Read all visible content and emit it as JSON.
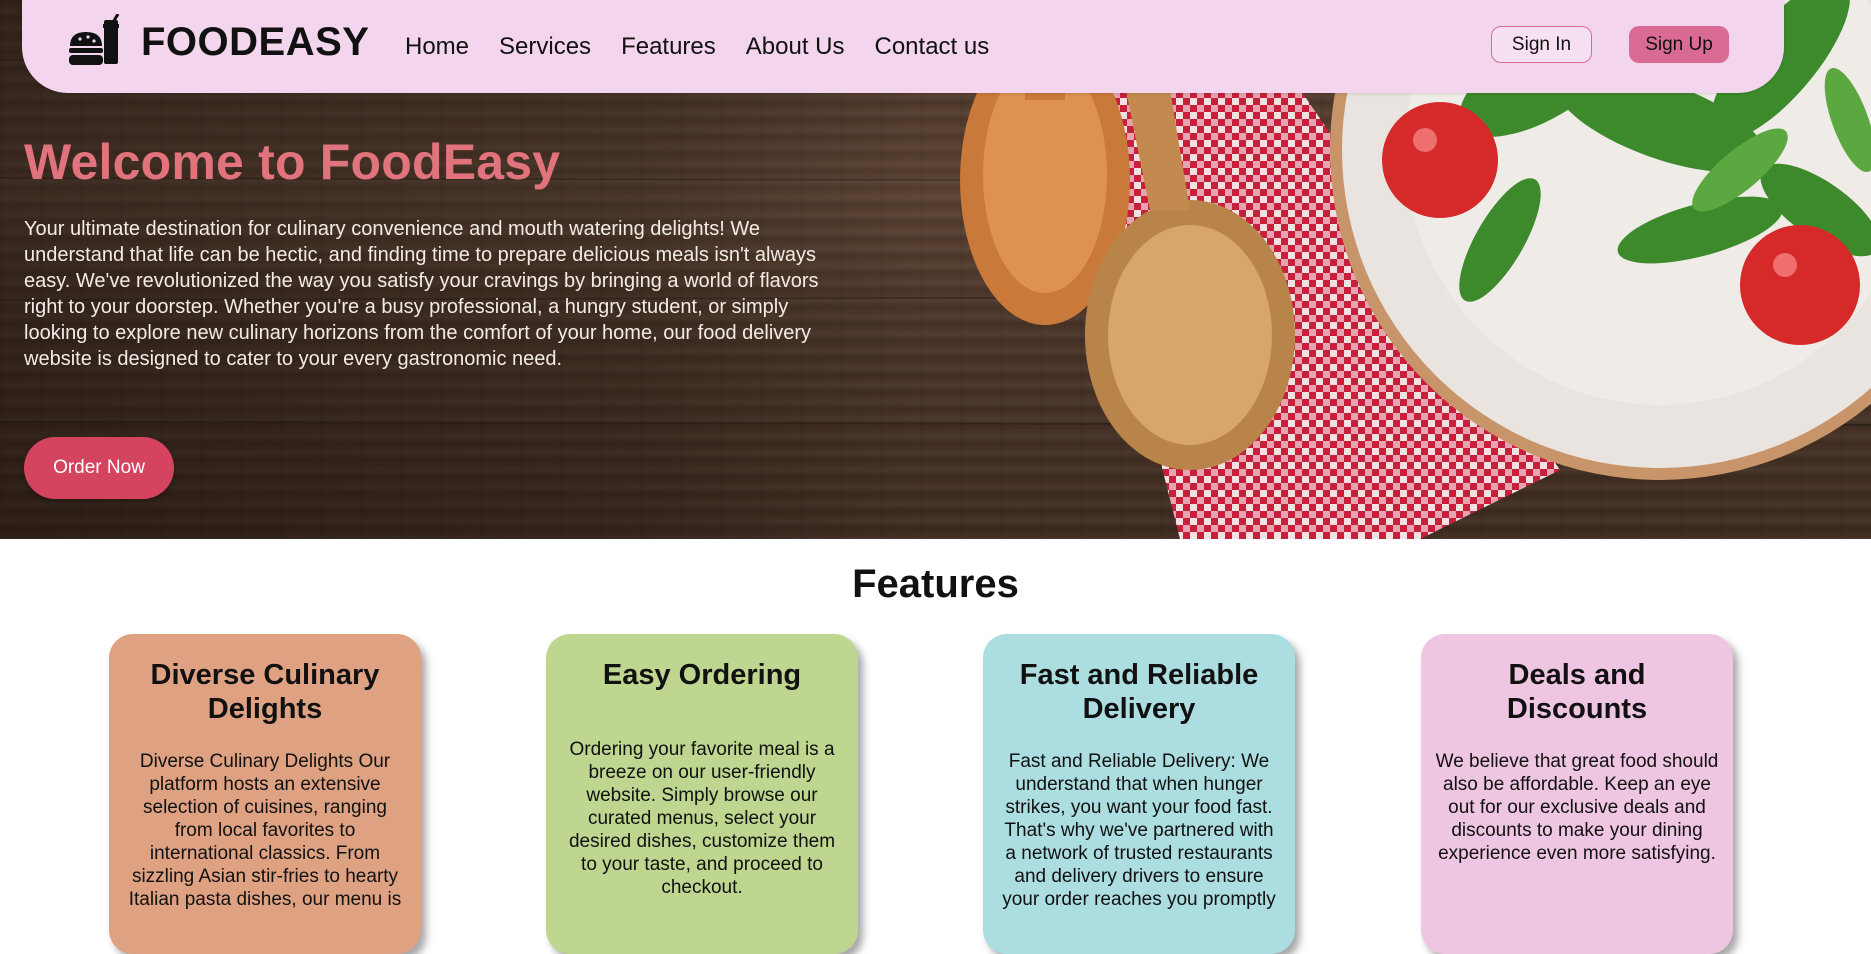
{
  "navbar": {
    "brand": "FOODEASY",
    "brand_icon": "burger-drink-icon",
    "links": [
      "Home",
      "Services",
      "Features",
      "About Us",
      "Contact us"
    ],
    "sign_in": "Sign In",
    "sign_up": "Sign Up",
    "background": "#f3d6ee"
  },
  "hero": {
    "title": "Welcome to FoodEasy",
    "text": "Your ultimate destination for culinary convenience and mouth watering delights! We understand that life can be hectic, and finding time to prepare delicious meals isn't always easy. We've revolutionized the way you satisfy your cravings by bringing a world of flavors right to your doorstep. Whether you're a busy professional, a hungry student, or simply looking to explore new culinary horizons from the comfort of your home, our food delivery website is designed to cater to your every gastronomic need.",
    "cta": "Order Now",
    "title_color": "#e0737c",
    "cta_color": "#d5445f"
  },
  "features": {
    "title": "Features",
    "cards": [
      {
        "title": "Diverse Culinary Delights",
        "text": "Diverse Culinary Delights Our platform hosts an extensive selection of cuisines, ranging from local favorites to international classics. From sizzling Asian stir-fries to hearty Italian pasta dishes, our menu is",
        "color": "#dea283"
      },
      {
        "title": "Easy Ordering",
        "text": "Ordering your favorite meal is a breeze on our user-friendly website. Simply browse our curated menus, select your desired dishes, customize them to your taste, and proceed to checkout.",
        "color": "#bed68f"
      },
      {
        "title": "Fast and Reliable Delivery",
        "text": "Fast and Reliable Delivery: We understand that when hunger strikes, you want your food fast. That's why we've partnered with a network of trusted restaurants and delivery drivers to ensure your order reaches you promptly",
        "color": "#acdde0"
      },
      {
        "title": "Deals and Discounts",
        "text": "We believe that great food should also be affordable. Keep an eye out for our exclusive deals and discounts to make your dining experience even more satisfying.",
        "color": "#efc6e2"
      }
    ]
  }
}
